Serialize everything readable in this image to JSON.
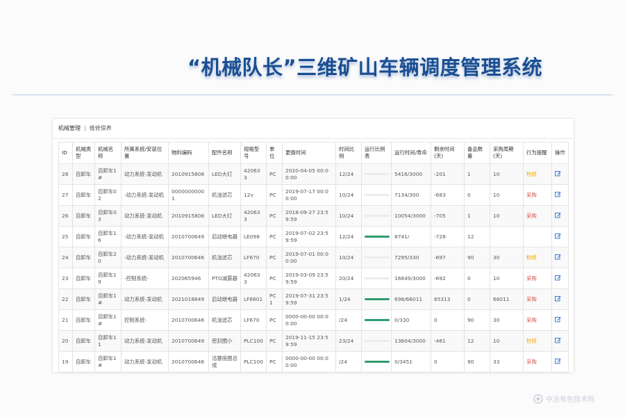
{
  "slide": {
    "title": "“机械队长”三维矿山车辆调度管理系统",
    "watermark": "中冶有色技术网"
  },
  "breadcrumb": {
    "root": "机械管理",
    "separator": "|",
    "current": "维修保养"
  },
  "colors": {
    "title": "#1a4e92",
    "maintenance": "#f0a500",
    "purchase": "#d9534f",
    "progress": "#2e9c6f",
    "edit_icon": "#3a7bd5"
  },
  "table": {
    "headers": [
      "ID",
      "机械类型",
      "机械名称",
      "所属系统/安装位置",
      "物料编码",
      "配件名称",
      "规格型号",
      "单位",
      "更换时间",
      "时间比例",
      "运行比例表",
      "运行时间/寿命",
      "剩余时间(天)",
      "备品数量",
      "采购周期(天)",
      "行为提醒",
      "操作"
    ],
    "rows": [
      {
        "id": "28",
        "type": "自卸车",
        "name": "自卸车1#",
        "system": "动力系统-发动机",
        "code": "2010915808",
        "part": "LED大灯",
        "spec": "420633",
        "unit": "PC",
        "time": "2020-04-05 00:00:00",
        "ratio": "12/24",
        "run_fraction": null,
        "run_life": "5416/3000",
        "remaining": "-201",
        "stock": "1",
        "cycle": "10",
        "reminder": "检修",
        "reminder_kind": "maintenance",
        "action_icon": "edit-icon"
      },
      {
        "id": "27",
        "type": "自卸车",
        "name": "自卸车02",
        "system": "-动力系统-发动机",
        "code": "00000000001",
        "part": "机油滤芯",
        "spec": "12v",
        "unit": "PC",
        "time": "2019-07-17 00:00:00",
        "ratio": "10/24",
        "run_fraction": null,
        "run_life": "7134/300",
        "remaining": "-683",
        "stock": "0",
        "cycle": "10",
        "reminder": "采购",
        "reminder_kind": "purchase",
        "action_icon": "edit-icon"
      },
      {
        "id": "26",
        "type": "自卸车",
        "name": "自卸车03",
        "system": "动力系统-发动机",
        "code": "2010915808",
        "part": "LED大灯",
        "spec": "420633",
        "unit": "PC",
        "time": "2018-09-27 23:59:59",
        "ratio": "10/24",
        "run_fraction": null,
        "run_life": "10054/3000",
        "remaining": "-705",
        "stock": "1",
        "cycle": "10",
        "reminder": "采购",
        "reminder_kind": "purchase",
        "action_icon": "edit-icon"
      },
      {
        "id": "25",
        "type": "自卸车",
        "name": "自卸车16",
        "system": "-动力系统-发动机",
        "code": "2010700649",
        "part": "启动继电器",
        "spec": "LE098",
        "unit": "PC",
        "time": "2019-07-02 23:59:59",
        "ratio": "12/24",
        "run_fraction": 1.0,
        "run_life": "8741/",
        "remaining": "-728",
        "stock": "12",
        "cycle": "",
        "reminder": "",
        "reminder_kind": "",
        "action_icon": "edit-icon"
      },
      {
        "id": "24",
        "type": "自卸车",
        "name": "自卸车20",
        "system": "-动力系统-发动机",
        "code": "2010700646",
        "part": "机油滤芯",
        "spec": "LF670",
        "unit": "PC",
        "time": "2019-07-01 00:00:00",
        "ratio": "10/24",
        "run_fraction": null,
        "run_life": "7295/330",
        "remaining": "-697",
        "stock": "90",
        "cycle": "30",
        "reminder": "检修",
        "reminder_kind": "maintenance",
        "action_icon": "edit-icon"
      },
      {
        "id": "23",
        "type": "自卸车",
        "name": "自卸车19",
        "system": "-控制系统-",
        "code": "202065946",
        "part": "PTO减震器",
        "spec": "420633",
        "unit": "PC",
        "time": "2019-03-09 23:59:59",
        "ratio": "20/24",
        "run_fraction": null,
        "run_life": "16849/3000",
        "remaining": "-692",
        "stock": "0",
        "cycle": "10",
        "reminder": "采购",
        "reminder_kind": "purchase",
        "action_icon": "edit-icon"
      },
      {
        "id": "22",
        "type": "自卸车",
        "name": "自卸车1#",
        "system": "动力系统-发动机",
        "code": "2021018849",
        "part": "启动继电器",
        "spec": "LF6601",
        "unit": "PC1",
        "time": "2019-07-31 23:59:59",
        "ratio": "1/24",
        "run_fraction": 1.0,
        "run_life": "698/66011",
        "remaining": "65313",
        "stock": "0",
        "cycle": "66011",
        "reminder": "采购",
        "reminder_kind": "purchase",
        "action_icon": "edit-icon"
      },
      {
        "id": "21",
        "type": "自卸车",
        "name": "自卸车1#",
        "system": "控制系统-",
        "code": "2010700646",
        "part": "机油滤芯",
        "spec": "LF670",
        "unit": "PC",
        "time": "0000-00-00 00:00:00",
        "ratio": "/24",
        "run_fraction": 1.0,
        "run_life": "0/330",
        "remaining": "0",
        "stock": "90",
        "cycle": "30",
        "reminder": "采购",
        "reminder_kind": "purchase",
        "action_icon": "edit-icon"
      },
      {
        "id": "20",
        "type": "自卸车",
        "name": "自卸车11",
        "system": "动力系统-发动机",
        "code": "2010700649",
        "part": "密封圈小",
        "spec": "PLC100",
        "unit": "PC",
        "time": "2019-11-15 23:59:59",
        "ratio": "23/24",
        "run_fraction": null,
        "run_life": "13604/3000",
        "remaining": "-461",
        "stock": "12",
        "cycle": "10",
        "reminder": "检修",
        "reminder_kind": "maintenance",
        "action_icon": "edit-icon"
      },
      {
        "id": "19",
        "type": "自卸车",
        "name": "自卸车1#",
        "system": "动力系统-发动机",
        "code": "2010700646",
        "part": "活塞座圈总成",
        "spec": "PLC100",
        "unit": "PC",
        "time": "0000-00-00 00:00:00",
        "ratio": "/24",
        "run_fraction": 1.0,
        "run_life": "0/3451",
        "remaining": "0",
        "stock": "90",
        "cycle": "33",
        "reminder": "采购",
        "reminder_kind": "purchase",
        "action_icon": "edit-icon"
      }
    ]
  }
}
